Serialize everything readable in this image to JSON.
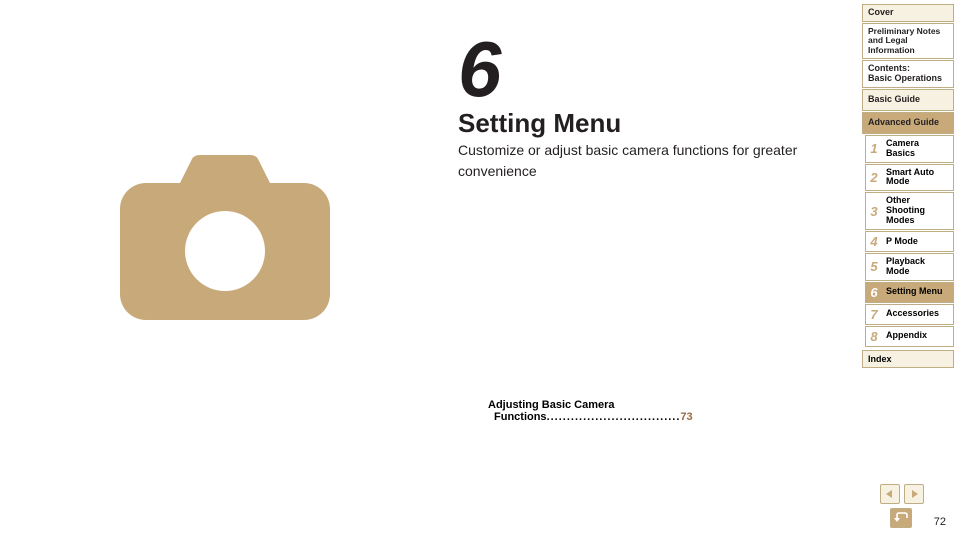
{
  "chapter": {
    "number": "6",
    "title": "Setting Menu",
    "subtitle": "Customize or adjust basic camera functions for greater convenience"
  },
  "toc": {
    "entry_line1": "Adjusting Basic Camera",
    "entry_line2": "Functions",
    "dots": ".................................",
    "page_ref": "73"
  },
  "sidebar": {
    "top": [
      {
        "label": "Cover"
      },
      {
        "label": "Preliminary Notes and Legal Information"
      },
      {
        "label": "Contents:\nBasic Operations"
      },
      {
        "label": "Basic Guide"
      }
    ],
    "advanced_header": "Advanced Guide",
    "advanced": [
      {
        "num": "1",
        "label": "Camera Basics"
      },
      {
        "num": "2",
        "label": "Smart Auto Mode"
      },
      {
        "num": "3",
        "label": "Other Shooting Modes"
      },
      {
        "num": "4",
        "label": "P Mode"
      },
      {
        "num": "5",
        "label": "Playback Mode"
      },
      {
        "num": "6",
        "label": "Setting Menu",
        "active": true
      },
      {
        "num": "7",
        "label": "Accessories"
      },
      {
        "num": "8",
        "label": "Appendix"
      }
    ],
    "index": "Index"
  },
  "page_number": "72"
}
